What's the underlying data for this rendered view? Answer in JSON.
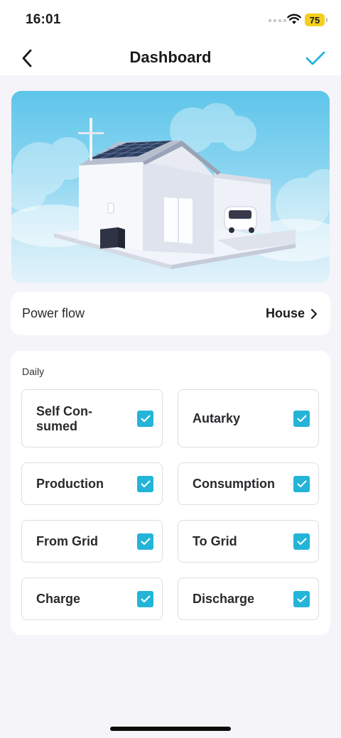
{
  "status_bar": {
    "time": "16:01",
    "battery": "75"
  },
  "nav": {
    "title": "Dashboard",
    "back_icon": "chevron-left-icon",
    "confirm_icon": "checkmark-icon"
  },
  "hero": {
    "image": "house-with-solar-panels-and-ev-illustration"
  },
  "power_flow": {
    "label": "Power flow",
    "value": "House",
    "icon": "chevron-right-icon"
  },
  "daily": {
    "label": "Daily",
    "items": [
      {
        "label": "Self Con-\nsumed",
        "checked": true
      },
      {
        "label": "Autarky",
        "checked": true
      },
      {
        "label": "Production",
        "checked": true
      },
      {
        "label": "Consumption",
        "checked": true
      },
      {
        "label": "From Grid",
        "checked": true
      },
      {
        "label": "To Grid",
        "checked": true
      },
      {
        "label": "Charge",
        "checked": true
      },
      {
        "label": "Discharge",
        "checked": true
      }
    ]
  },
  "colors": {
    "accent": "#23b4d8",
    "background": "#f5f4f9",
    "battery": "#f4cf1f"
  }
}
